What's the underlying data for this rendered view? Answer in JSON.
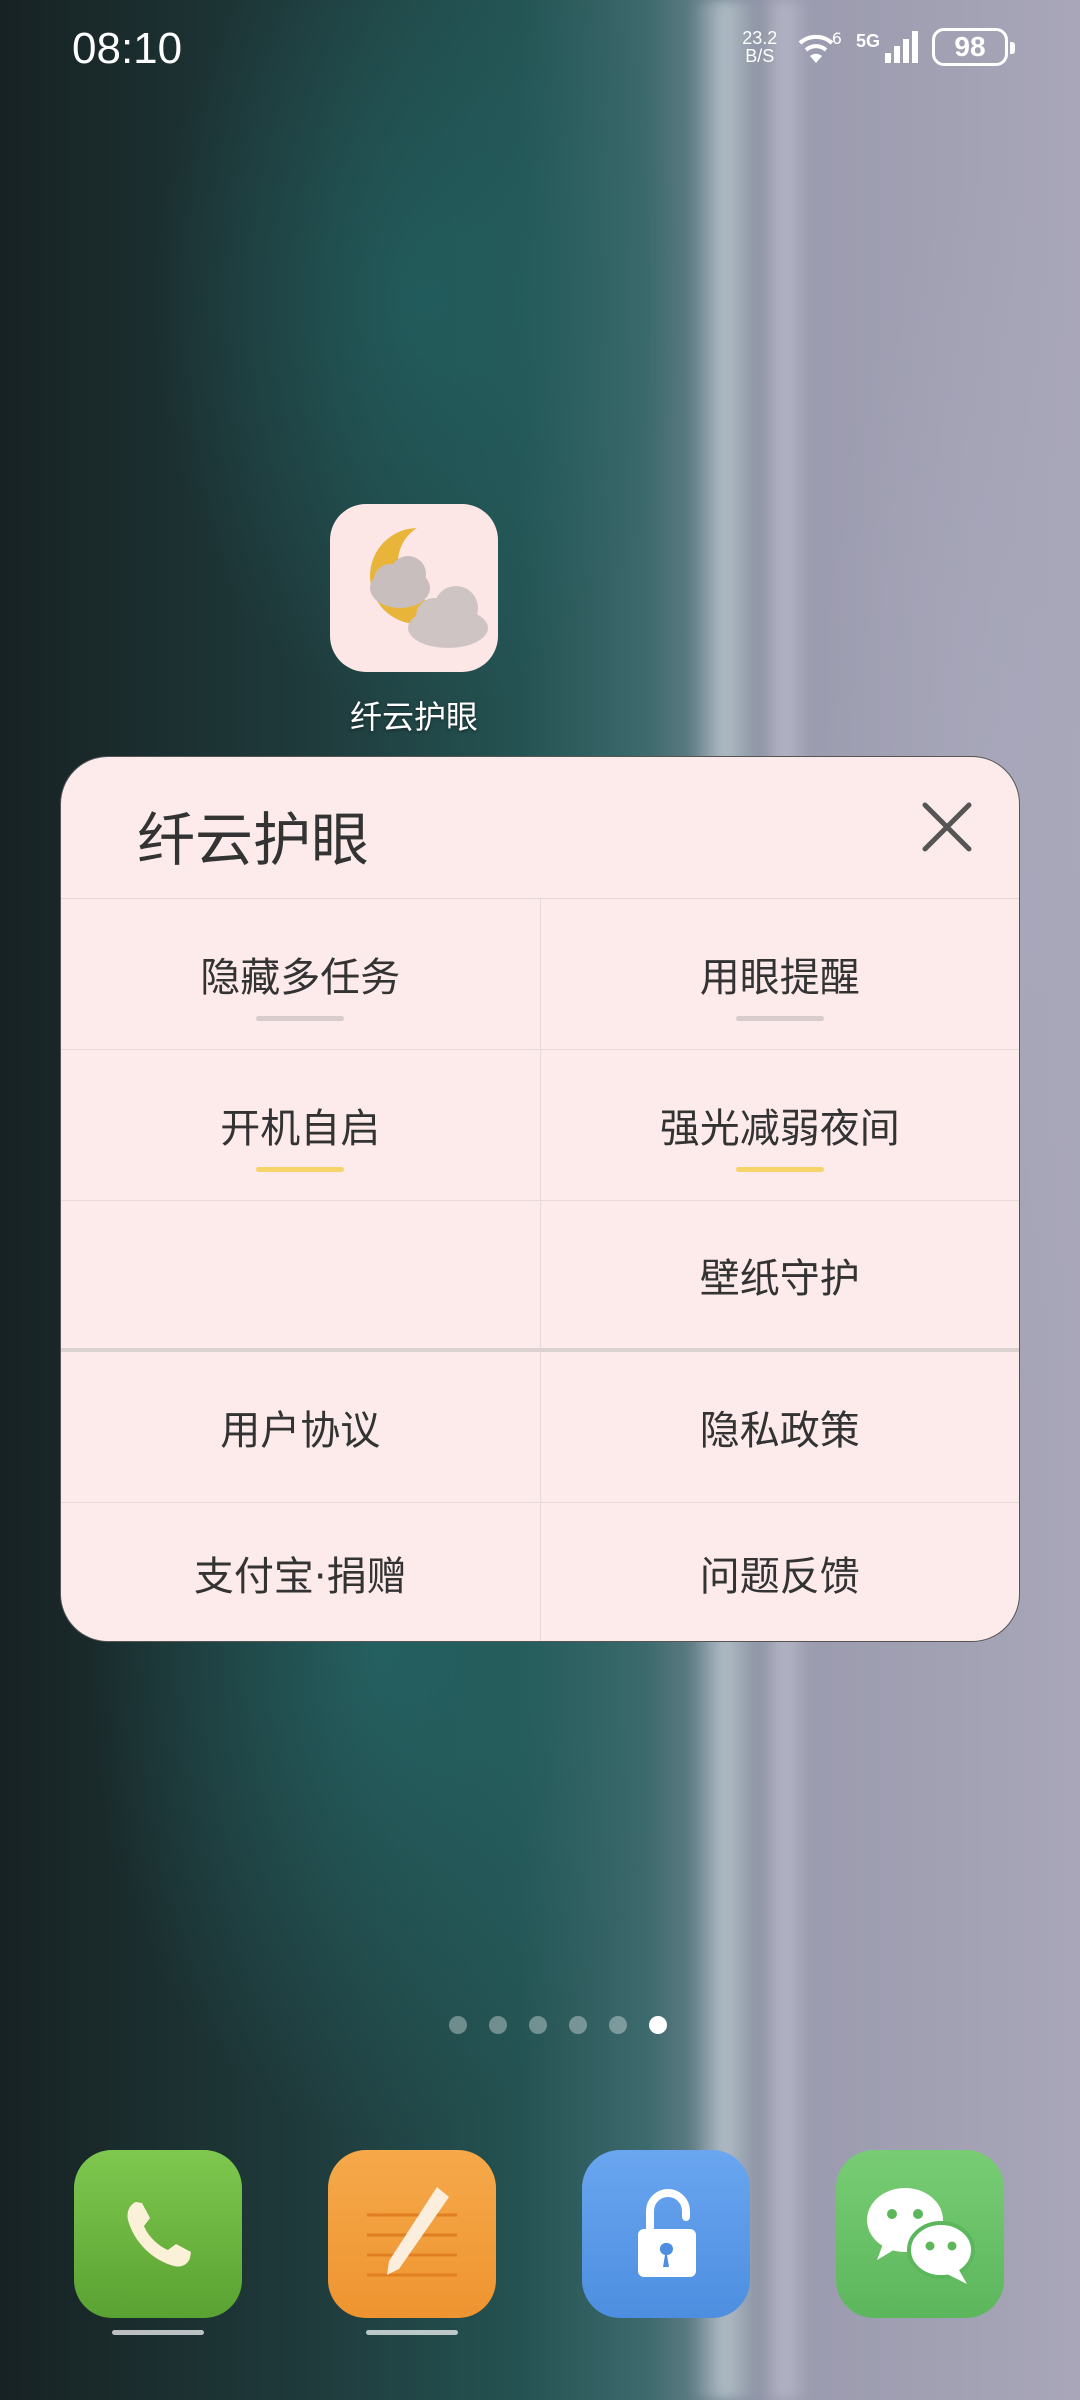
{
  "status_bar": {
    "time": "08:10",
    "net_speed_value": "23.2",
    "net_speed_unit": "B/S",
    "wifi_label": "6",
    "network_type": "5G",
    "battery": "98"
  },
  "home_app": {
    "label": "纤云护眼",
    "icon": "moon-cloud-icon"
  },
  "panel": {
    "title": "纤云护眼",
    "close_icon": "close-icon",
    "rows": [
      {
        "left": {
          "label": "隐藏多任务",
          "toggle_on": false
        },
        "right": {
          "label": "用眼提醒",
          "toggle_on": false
        }
      },
      {
        "left": {
          "label": "开机自启",
          "toggle_on": true
        },
        "right": {
          "label": "强光减弱夜间",
          "toggle_on": true
        }
      },
      {
        "left": {
          "label": ""
        },
        "right": {
          "label": "壁纸守护"
        }
      },
      {
        "left": {
          "label": "用户协议"
        },
        "right": {
          "label": "隐私政策"
        }
      },
      {
        "left": {
          "label": "支付宝·捐赠"
        },
        "right": {
          "label": "问题反馈"
        }
      }
    ]
  },
  "page_indicator": {
    "total": 6,
    "current": 6
  },
  "dock": [
    {
      "name": "phone",
      "icon": "phone-icon",
      "color": "#6fb544"
    },
    {
      "name": "notes",
      "icon": "pencil-icon",
      "color": "#f2a03e"
    },
    {
      "name": "lock",
      "icon": "unlock-icon",
      "color": "#5b9ae8"
    },
    {
      "name": "wechat",
      "icon": "wechat-icon",
      "color": "#6bc26a"
    }
  ],
  "colors": {
    "panel_bg": "#fdebeb",
    "toggle_on": "#f6d46a",
    "toggle_off": "#d9cccc"
  }
}
